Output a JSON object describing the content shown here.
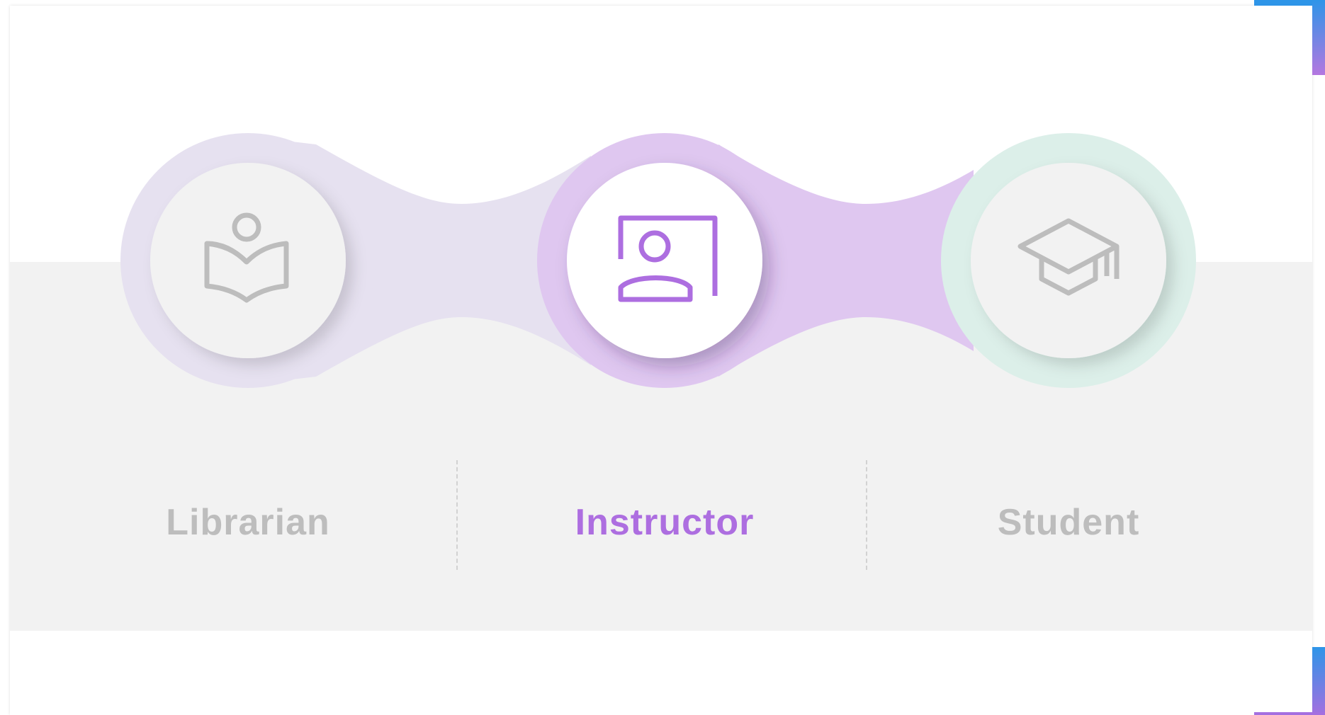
{
  "roles": [
    {
      "id": "librarian",
      "label": "Librarian",
      "icon": "open-book-reader-icon",
      "selected": false
    },
    {
      "id": "instructor",
      "label": "Instructor",
      "icon": "presenter-board-icon",
      "selected": true
    },
    {
      "id": "student",
      "label": "Student",
      "icon": "graduation-cap-icon",
      "selected": false
    }
  ],
  "colors": {
    "active": "#ad6ee0",
    "inactive": "#bdbdbd",
    "librarian_ring": "#e6e1f0",
    "instructor_ring": "#dfc7f0",
    "student_ring": "#dcefe9",
    "band": "#f2f2f2",
    "accent_blue": "#2e95e8"
  }
}
